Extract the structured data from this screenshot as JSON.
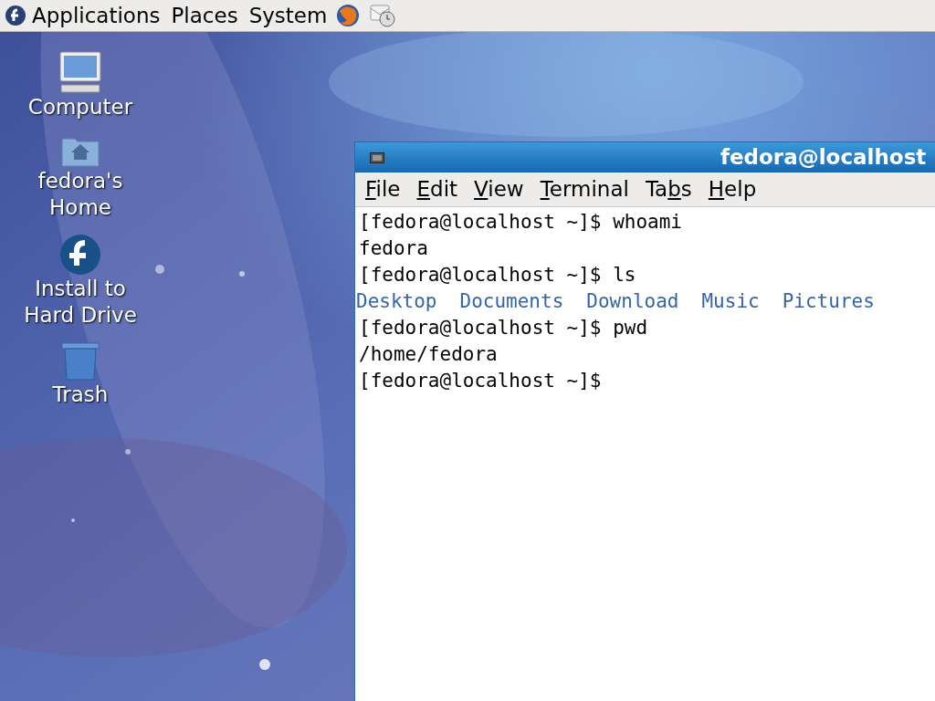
{
  "top_panel": {
    "menus": [
      "Applications",
      "Places",
      "System"
    ]
  },
  "desktop_icons": [
    {
      "kind": "computer",
      "label": "Computer"
    },
    {
      "kind": "home",
      "label": "fedora's\nHome"
    },
    {
      "kind": "install",
      "label": "Install to\nHard Drive"
    },
    {
      "kind": "trash",
      "label": "Trash"
    }
  ],
  "terminal": {
    "title": "fedora@localhost",
    "menu": [
      {
        "key": "F",
        "post": "ile"
      },
      {
        "key": "E",
        "post": "dit"
      },
      {
        "key": "V",
        "post": "iew"
      },
      {
        "key": "T",
        "post": "erminal"
      },
      {
        "pre": "Ta",
        "key": "b",
        "post": "s"
      },
      {
        "key": "H",
        "post": "elp"
      }
    ],
    "lines": [
      {
        "kind": "prompt",
        "prompt": "[fedora@localhost ~]$",
        "command": "whoami"
      },
      {
        "kind": "output",
        "text": "fedora"
      },
      {
        "kind": "prompt",
        "prompt": "[fedora@localhost ~]$",
        "command": "ls"
      },
      {
        "kind": "listing",
        "items": [
          "Desktop",
          "Documents",
          "Download",
          "Music",
          "Pictures"
        ]
      },
      {
        "kind": "prompt",
        "prompt": "[fedora@localhost ~]$",
        "command": "pwd"
      },
      {
        "kind": "output",
        "text": "/home/fedora"
      },
      {
        "kind": "prompt",
        "prompt": "[fedora@localhost ~]$"
      }
    ]
  }
}
